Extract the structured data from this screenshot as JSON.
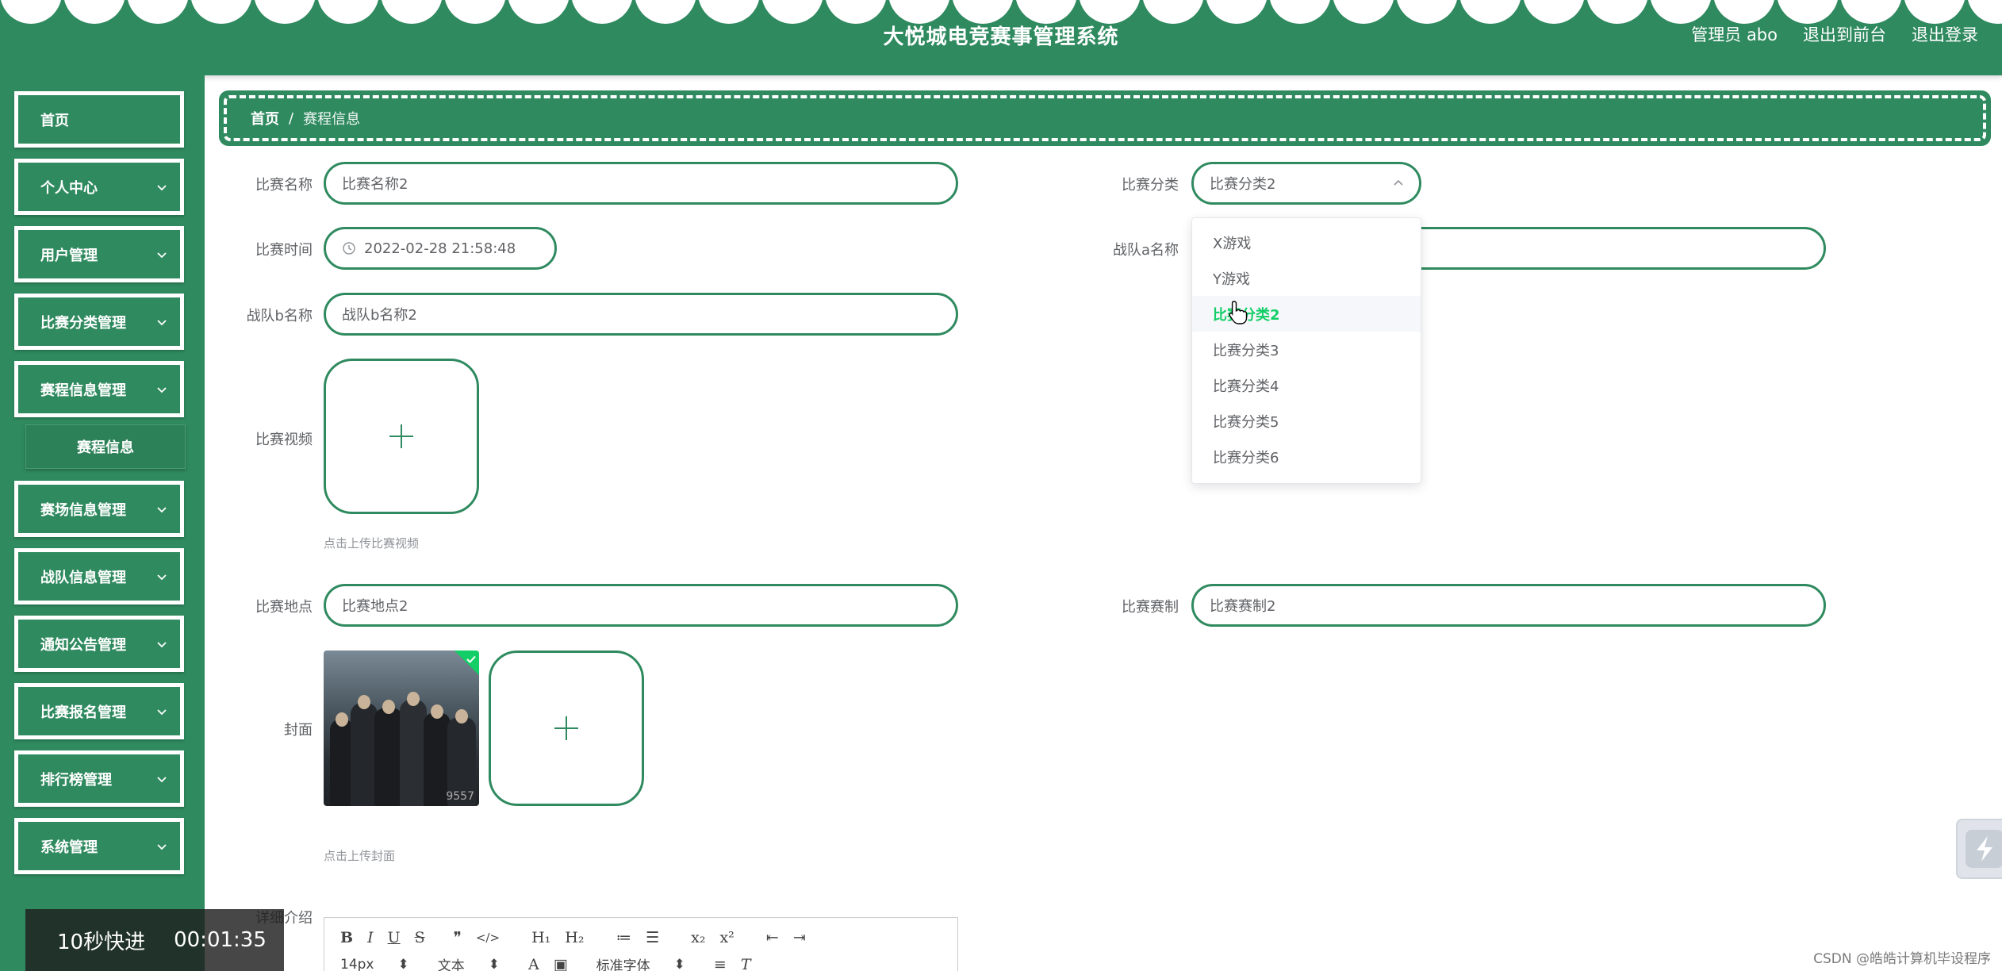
{
  "header": {
    "title": "大悦城电竞赛事管理系统",
    "links": [
      "管理员 abo",
      "退出到前台",
      "退出登录"
    ]
  },
  "sidebar": {
    "items": [
      {
        "label": "首页",
        "has_children": false
      },
      {
        "label": "个人中心",
        "has_children": true
      },
      {
        "label": "用户管理",
        "has_children": true
      },
      {
        "label": "比赛分类管理",
        "has_children": true
      },
      {
        "label": "赛程信息管理",
        "has_children": true
      },
      {
        "label": "赛场信息管理",
        "has_children": true
      },
      {
        "label": "战队信息管理",
        "has_children": true
      },
      {
        "label": "通知公告管理",
        "has_children": true
      },
      {
        "label": "比赛报名管理",
        "has_children": true
      },
      {
        "label": "排行榜管理",
        "has_children": true
      },
      {
        "label": "系统管理",
        "has_children": true
      }
    ],
    "subitem": "赛程信息"
  },
  "breadcrumb": {
    "home": "首页",
    "separator": "/",
    "current": "赛程信息"
  },
  "form": {
    "match_name": {
      "label": "比赛名称",
      "value": "比赛名称2"
    },
    "category": {
      "label": "比赛分类",
      "value": "比赛分类2"
    },
    "match_time": {
      "label": "比赛时间",
      "value": "2022-02-28 21:58:48"
    },
    "team_a": {
      "label": "战队a名称",
      "value": ""
    },
    "team_b": {
      "label": "战队b名称",
      "value": "战队b名称2"
    },
    "video": {
      "label": "比赛视频",
      "hint": "点击上传比赛视频"
    },
    "location": {
      "label": "比赛地点",
      "value": "比赛地点2"
    },
    "format": {
      "label": "比赛赛制",
      "value": "比赛赛制2"
    },
    "cover": {
      "label": "封面",
      "hint": "点击上传封面",
      "watermark": "9557"
    },
    "details": {
      "label": "详细介绍"
    }
  },
  "dropdown": {
    "options": [
      "X游戏",
      "Y游戏",
      "比赛分类2",
      "比赛分类3",
      "比赛分类4",
      "比赛分类5",
      "比赛分类6"
    ],
    "selected": "比赛分类2"
  },
  "editor": {
    "row1": [
      "B",
      "I",
      "U",
      "S",
      "❞",
      "</>",
      "H₁",
      "H₂",
      "≔",
      "☰",
      "x₂",
      "x²",
      "⇤",
      "⇥"
    ],
    "font_size": "14px",
    "text_type": "文本",
    "font_family": "标准字体"
  },
  "video_overlay": {
    "fast_forward": "10秒快进",
    "time": "00:01:35"
  },
  "watermark": "CSDN @皓皓计算机毕设程序",
  "colors": {
    "primary": "#2f8a5f",
    "selected_option": "#13ce66"
  }
}
